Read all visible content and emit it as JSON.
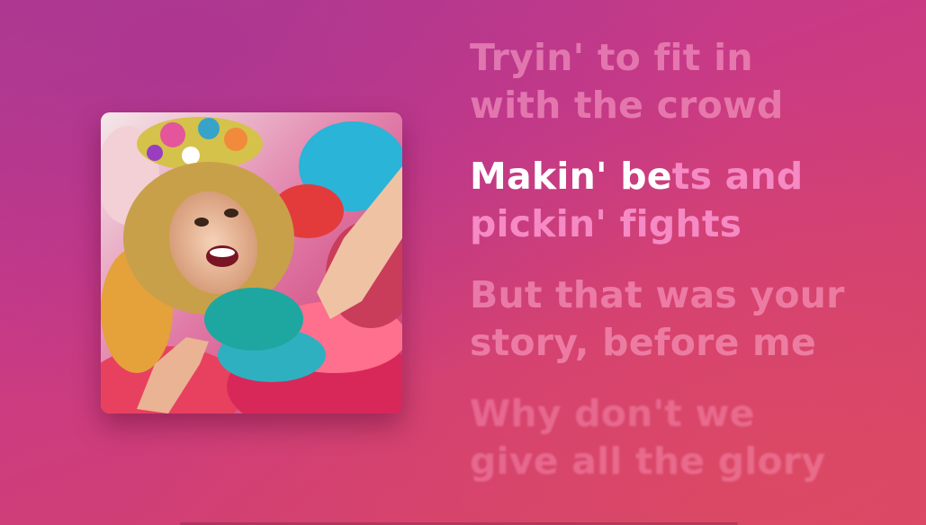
{
  "album": {
    "artwork_icon": "album-artwork-festival-photo"
  },
  "lyrics": {
    "previous": {
      "row1": "Tryin' to fit in",
      "row2": "with the crowd"
    },
    "current": {
      "row1_sung": "Makin' be",
      "row1_unsung": "ts and",
      "row2": "pickin' fights"
    },
    "next": {
      "row1": "But that was your",
      "row2": "story, before me"
    },
    "upcoming": {
      "row1": "Why don't we",
      "row2": "give all the glory"
    }
  },
  "colors": {
    "background_start": "#b53c8e",
    "background_end": "#d4456a",
    "active_text": "#ffffff",
    "pending_text": "#f58ac4"
  }
}
